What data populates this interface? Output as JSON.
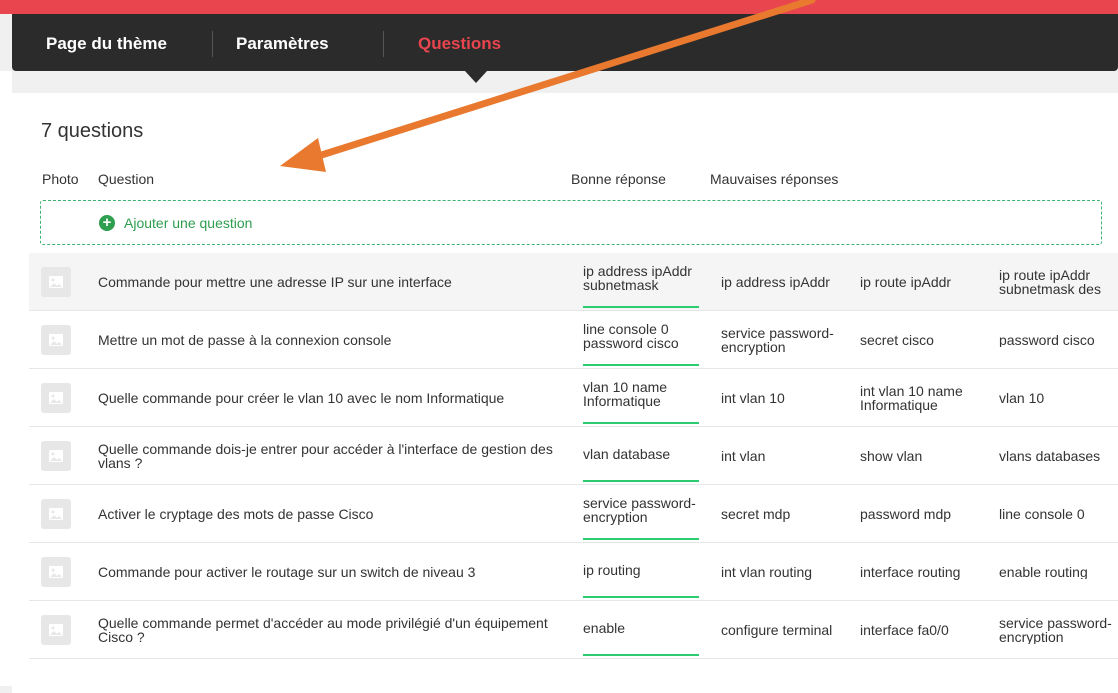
{
  "nav": {
    "tabs": [
      {
        "label": "Page du thème"
      },
      {
        "label": "Paramètres"
      },
      {
        "label": "Questions",
        "active": true
      }
    ]
  },
  "panel": {
    "count_title": "7 questions",
    "headers": {
      "photo": "Photo",
      "question": "Question",
      "good": "Bonne réponse",
      "bad": "Mauvaises réponses"
    },
    "add_label": "Ajouter une question"
  },
  "rows": [
    {
      "question": "Commande pour mettre une adresse IP sur une interface",
      "good": "ip address ipAddr subnetmask",
      "bad": [
        "ip address ipAddr",
        "ip route ipAddr",
        "ip route ipAddr subnetmask des"
      ]
    },
    {
      "question": "Mettre un mot de passe à la connexion console",
      "good": "line console 0 password cisco",
      "bad": [
        "service password-encryption",
        "secret cisco",
        "password cisco"
      ]
    },
    {
      "question": "Quelle commande pour créer le vlan 10 avec le nom Informatique",
      "good": "vlan 10 name Informatique",
      "bad": [
        "int vlan 10",
        "int vlan 10 name Informatique",
        "vlan 10"
      ]
    },
    {
      "question": "Quelle commande dois-je entrer pour accéder à l'interface de gestion des vlans ?",
      "good": "vlan database",
      "bad": [
        "int vlan",
        "show vlan",
        "vlans databases"
      ]
    },
    {
      "question": "Activer le cryptage des mots de passe Cisco",
      "good": "service password-encryption",
      "bad": [
        "secret mdp",
        "password mdp",
        "line console 0"
      ]
    },
    {
      "question": "Commande pour activer le routage sur un switch de niveau 3",
      "good": "ip routing",
      "bad": [
        "int vlan routing",
        "interface routing",
        "enable routing"
      ]
    },
    {
      "question": "Quelle commande permet d'accéder au mode privilégié d'un équipement Cisco ?",
      "good": "enable",
      "bad": [
        "configure terminal",
        "interface fa0/0",
        "service password-encryption"
      ]
    }
  ],
  "colors": {
    "accent": "#e8454f",
    "nav_bg": "#2b2b2b",
    "green": "#2ecc71",
    "arrow": "#e8792e"
  },
  "icons": {
    "add": "plus-circle-icon",
    "photo": "image-placeholder-icon",
    "annotation": "orange-arrow-icon"
  }
}
